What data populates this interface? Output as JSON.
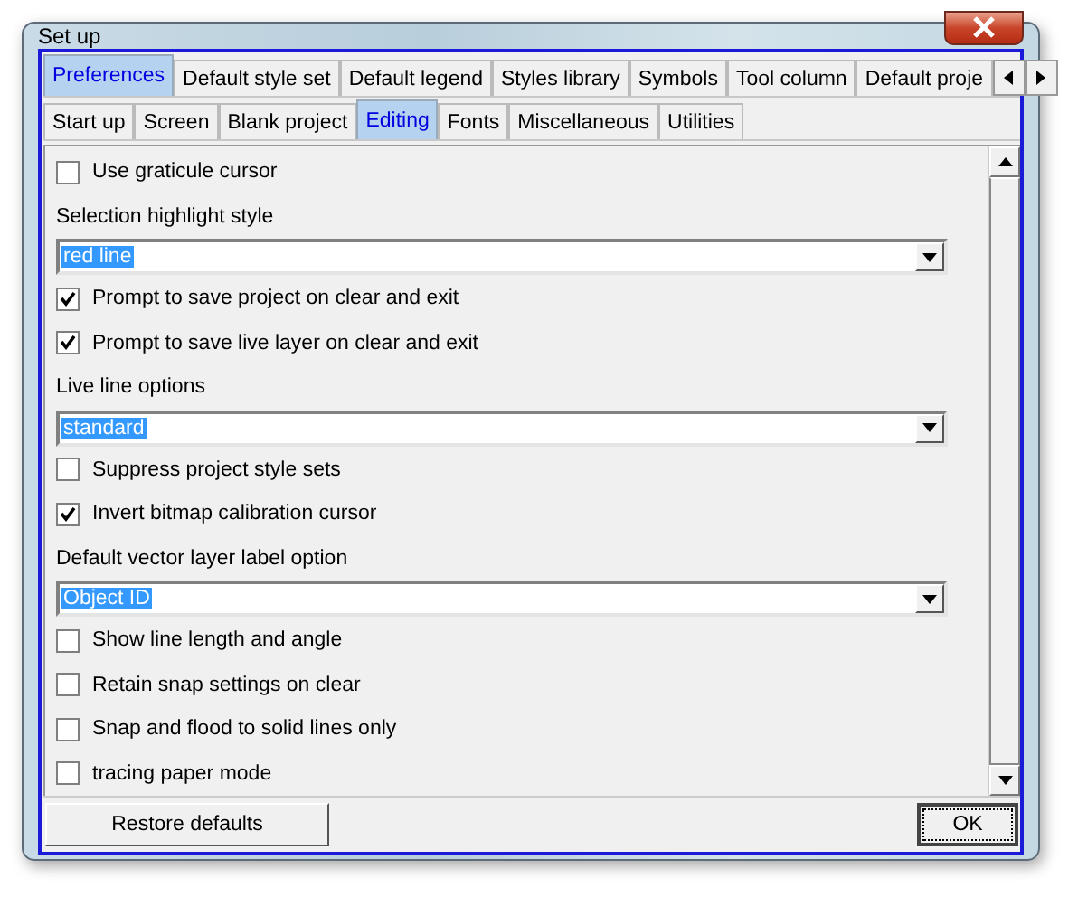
{
  "window": {
    "title": "Set up"
  },
  "tabs": [
    {
      "label": "Preferences",
      "selected": true
    },
    {
      "label": "Default style set",
      "selected": false
    },
    {
      "label": "Default legend",
      "selected": false
    },
    {
      "label": "Styles library",
      "selected": false
    },
    {
      "label": "Symbols",
      "selected": false
    },
    {
      "label": "Tool column",
      "selected": false
    },
    {
      "label": "Default proje",
      "selected": false
    }
  ],
  "subtabs": [
    {
      "label": "Start up",
      "selected": false
    },
    {
      "label": "Screen",
      "selected": false
    },
    {
      "label": "Blank project",
      "selected": false
    },
    {
      "label": "Editing",
      "selected": true
    },
    {
      "label": "Fonts",
      "selected": false
    },
    {
      "label": "Miscellaneous",
      "selected": false
    },
    {
      "label": "Utilities",
      "selected": false
    }
  ],
  "options": [
    {
      "kind": "checkbox",
      "label": "Use graticule cursor",
      "checked": false
    },
    {
      "kind": "label",
      "label": "Selection highlight style"
    },
    {
      "kind": "dropdown",
      "value": "red line"
    },
    {
      "kind": "checkbox",
      "label": "Prompt to save project on clear and exit",
      "checked": true
    },
    {
      "kind": "checkbox",
      "label": "Prompt to save live layer on clear and exit",
      "checked": true
    },
    {
      "kind": "label",
      "label": "Live line options"
    },
    {
      "kind": "dropdown",
      "value": "standard"
    },
    {
      "kind": "checkbox",
      "label": "Suppress project style sets",
      "checked": false
    },
    {
      "kind": "checkbox",
      "label": "Invert bitmap calibration cursor",
      "checked": true
    },
    {
      "kind": "label",
      "label": "Default vector layer label option"
    },
    {
      "kind": "dropdown",
      "value": "Object ID"
    },
    {
      "kind": "checkbox",
      "label": "Show line length and angle",
      "checked": false
    },
    {
      "kind": "checkbox",
      "label": "Retain snap settings on clear",
      "checked": false
    },
    {
      "kind": "checkbox",
      "label": "Snap and flood to solid lines only",
      "checked": false
    },
    {
      "kind": "checkbox",
      "label": "tracing paper mode",
      "checked": false
    }
  ],
  "buttons": [
    {
      "label": "Restore defaults"
    },
    {
      "label": "OK"
    }
  ]
}
